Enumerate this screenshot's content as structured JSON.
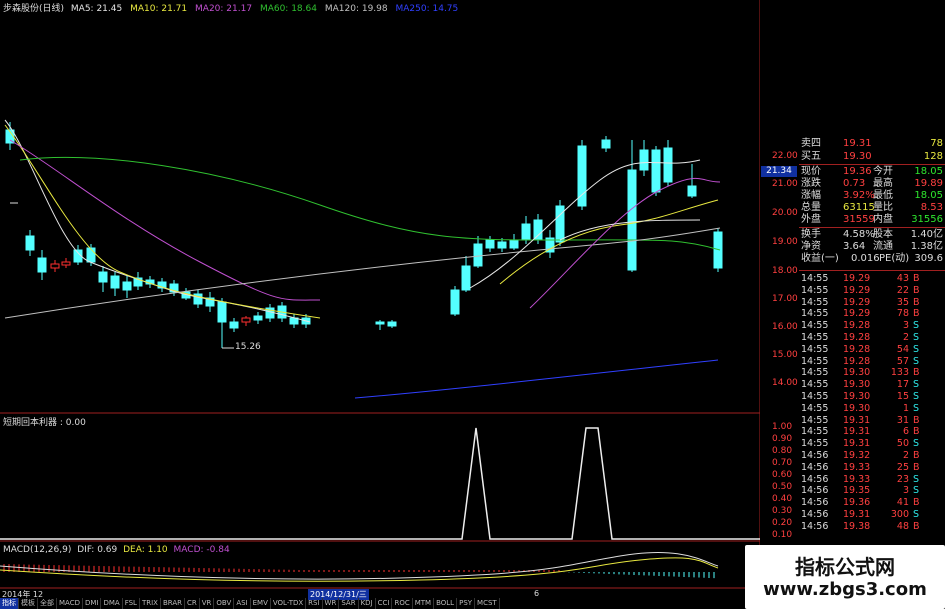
{
  "stock": {
    "name": "步森股份(日线)"
  },
  "ma_line": {
    "ma5": "MA5: 21.45",
    "ma10": "MA10: 21.71",
    "ma20": "MA20: 21.17",
    "ma60": "MA60: 18.64",
    "ma120": "MA120: 19.98",
    "ma250": "MA250: 14.75"
  },
  "colors": {
    "up": "#ff3030",
    "down": "#54ffff",
    "ma5": "#e6e6e6",
    "ma10": "#e8e840",
    "ma20": "#c050d0",
    "ma60": "#30c030",
    "ma120": "#c0c0c0",
    "ma250": "#3040ff"
  },
  "price_axis": [
    "22.00",
    "21.00",
    "20.00",
    "19.00",
    "18.00",
    "17.00",
    "16.00",
    "15.00",
    "14.00"
  ],
  "low_label": "15.26",
  "current_price_tag": "21.34",
  "quote": {
    "ask5_label": "卖四",
    "ask5_price": "19.31",
    "ask5_vol": "78",
    "ask4_label": "买五",
    "ask4_price": "19.30",
    "ask4_vol": "128",
    "rows": [
      {
        "l1": "现价",
        "v1": "19.36",
        "l2": "今开",
        "v2": "18.05"
      },
      {
        "l1": "涨跌",
        "v1": "0.73",
        "l2": "最高",
        "v2": "19.89"
      },
      {
        "l1": "涨幅",
        "v1": "3.92%",
        "l2": "最低",
        "v2": "18.05"
      },
      {
        "l1": "总量",
        "v1": "63115",
        "l2": "量比",
        "v2": "8.53"
      },
      {
        "l1": "外盘",
        "v1": "31559",
        "l2": "内盘",
        "v2": "31556"
      },
      {
        "l1": "换手",
        "v1": "4.58%",
        "l2": "股本",
        "v2": "1.40亿"
      },
      {
        "l1": "净资",
        "v1": "3.64",
        "l2": "流通",
        "v2": "1.38亿"
      },
      {
        "l1": "收益(一)",
        "v1": "0.016",
        "l2": "PE(动)",
        "v2": "309.6"
      }
    ]
  },
  "trades": [
    {
      "t": "14:55",
      "p": "19.29",
      "v": "43",
      "d": "B"
    },
    {
      "t": "14:55",
      "p": "19.29",
      "v": "22",
      "d": "B"
    },
    {
      "t": "14:55",
      "p": "19.29",
      "v": "35",
      "d": "B"
    },
    {
      "t": "14:55",
      "p": "19.29",
      "v": "78",
      "d": "B"
    },
    {
      "t": "14:55",
      "p": "19.28",
      "v": "3",
      "d": "S"
    },
    {
      "t": "14:55",
      "p": "19.28",
      "v": "2",
      "d": "S"
    },
    {
      "t": "14:55",
      "p": "19.28",
      "v": "54",
      "d": "S"
    },
    {
      "t": "14:55",
      "p": "19.28",
      "v": "57",
      "d": "S"
    },
    {
      "t": "14:55",
      "p": "19.30",
      "v": "133",
      "d": "B"
    },
    {
      "t": "14:55",
      "p": "19.30",
      "v": "17",
      "d": "S"
    },
    {
      "t": "14:55",
      "p": "19.30",
      "v": "15",
      "d": "S"
    },
    {
      "t": "14:55",
      "p": "19.30",
      "v": "1",
      "d": "S"
    },
    {
      "t": "14:55",
      "p": "19.31",
      "v": "31",
      "d": "B"
    },
    {
      "t": "14:55",
      "p": "19.31",
      "v": "6",
      "d": "B"
    },
    {
      "t": "14:55",
      "p": "19.31",
      "v": "50",
      "d": "S"
    },
    {
      "t": "14:56",
      "p": "19.32",
      "v": "2",
      "d": "B"
    },
    {
      "t": "14:56",
      "p": "19.33",
      "v": "25",
      "d": "B"
    },
    {
      "t": "14:56",
      "p": "19.33",
      "v": "23",
      "d": "S"
    },
    {
      "t": "14:56",
      "p": "19.35",
      "v": "3",
      "d": "S"
    },
    {
      "t": "14:56",
      "p": "19.36",
      "v": "41",
      "d": "B"
    },
    {
      "t": "14:56",
      "p": "19.31",
      "v": "300",
      "d": "S"
    },
    {
      "t": "14:56",
      "p": "19.38",
      "v": "48",
      "d": "B"
    }
  ],
  "indicator": {
    "title": "短期回本利器 : 0.00",
    "axis": [
      "1.00",
      "0.90",
      "0.80",
      "0.70",
      "0.60",
      "0.50",
      "0.40",
      "0.30",
      "0.20",
      "0.10"
    ]
  },
  "macd": {
    "title": "MACD(12,26,9)",
    "dif": "DIF: 0.69",
    "dea": "DEA: 1.10",
    "macd": "MACD: -0.84"
  },
  "date_bar": {
    "left": "2014年 12",
    "mid": "2014/12/31/三",
    "right": "6"
  },
  "tabs": [
    "指标",
    "模板",
    "全部",
    "MACD",
    "DMI",
    "DMA",
    "FSL",
    "TRIX",
    "BRAR",
    "CR",
    "VR",
    "OBV",
    "ASI",
    "EMV",
    "VOL-TDX",
    "RSI",
    "WR",
    "SAR",
    "KDJ",
    "CCI",
    "ROC",
    "MTM",
    "BOLL",
    "PSY",
    "MCST"
  ],
  "watermark": {
    "line1": "指标公式网",
    "line2": "www.zbgs3.com"
  }
}
